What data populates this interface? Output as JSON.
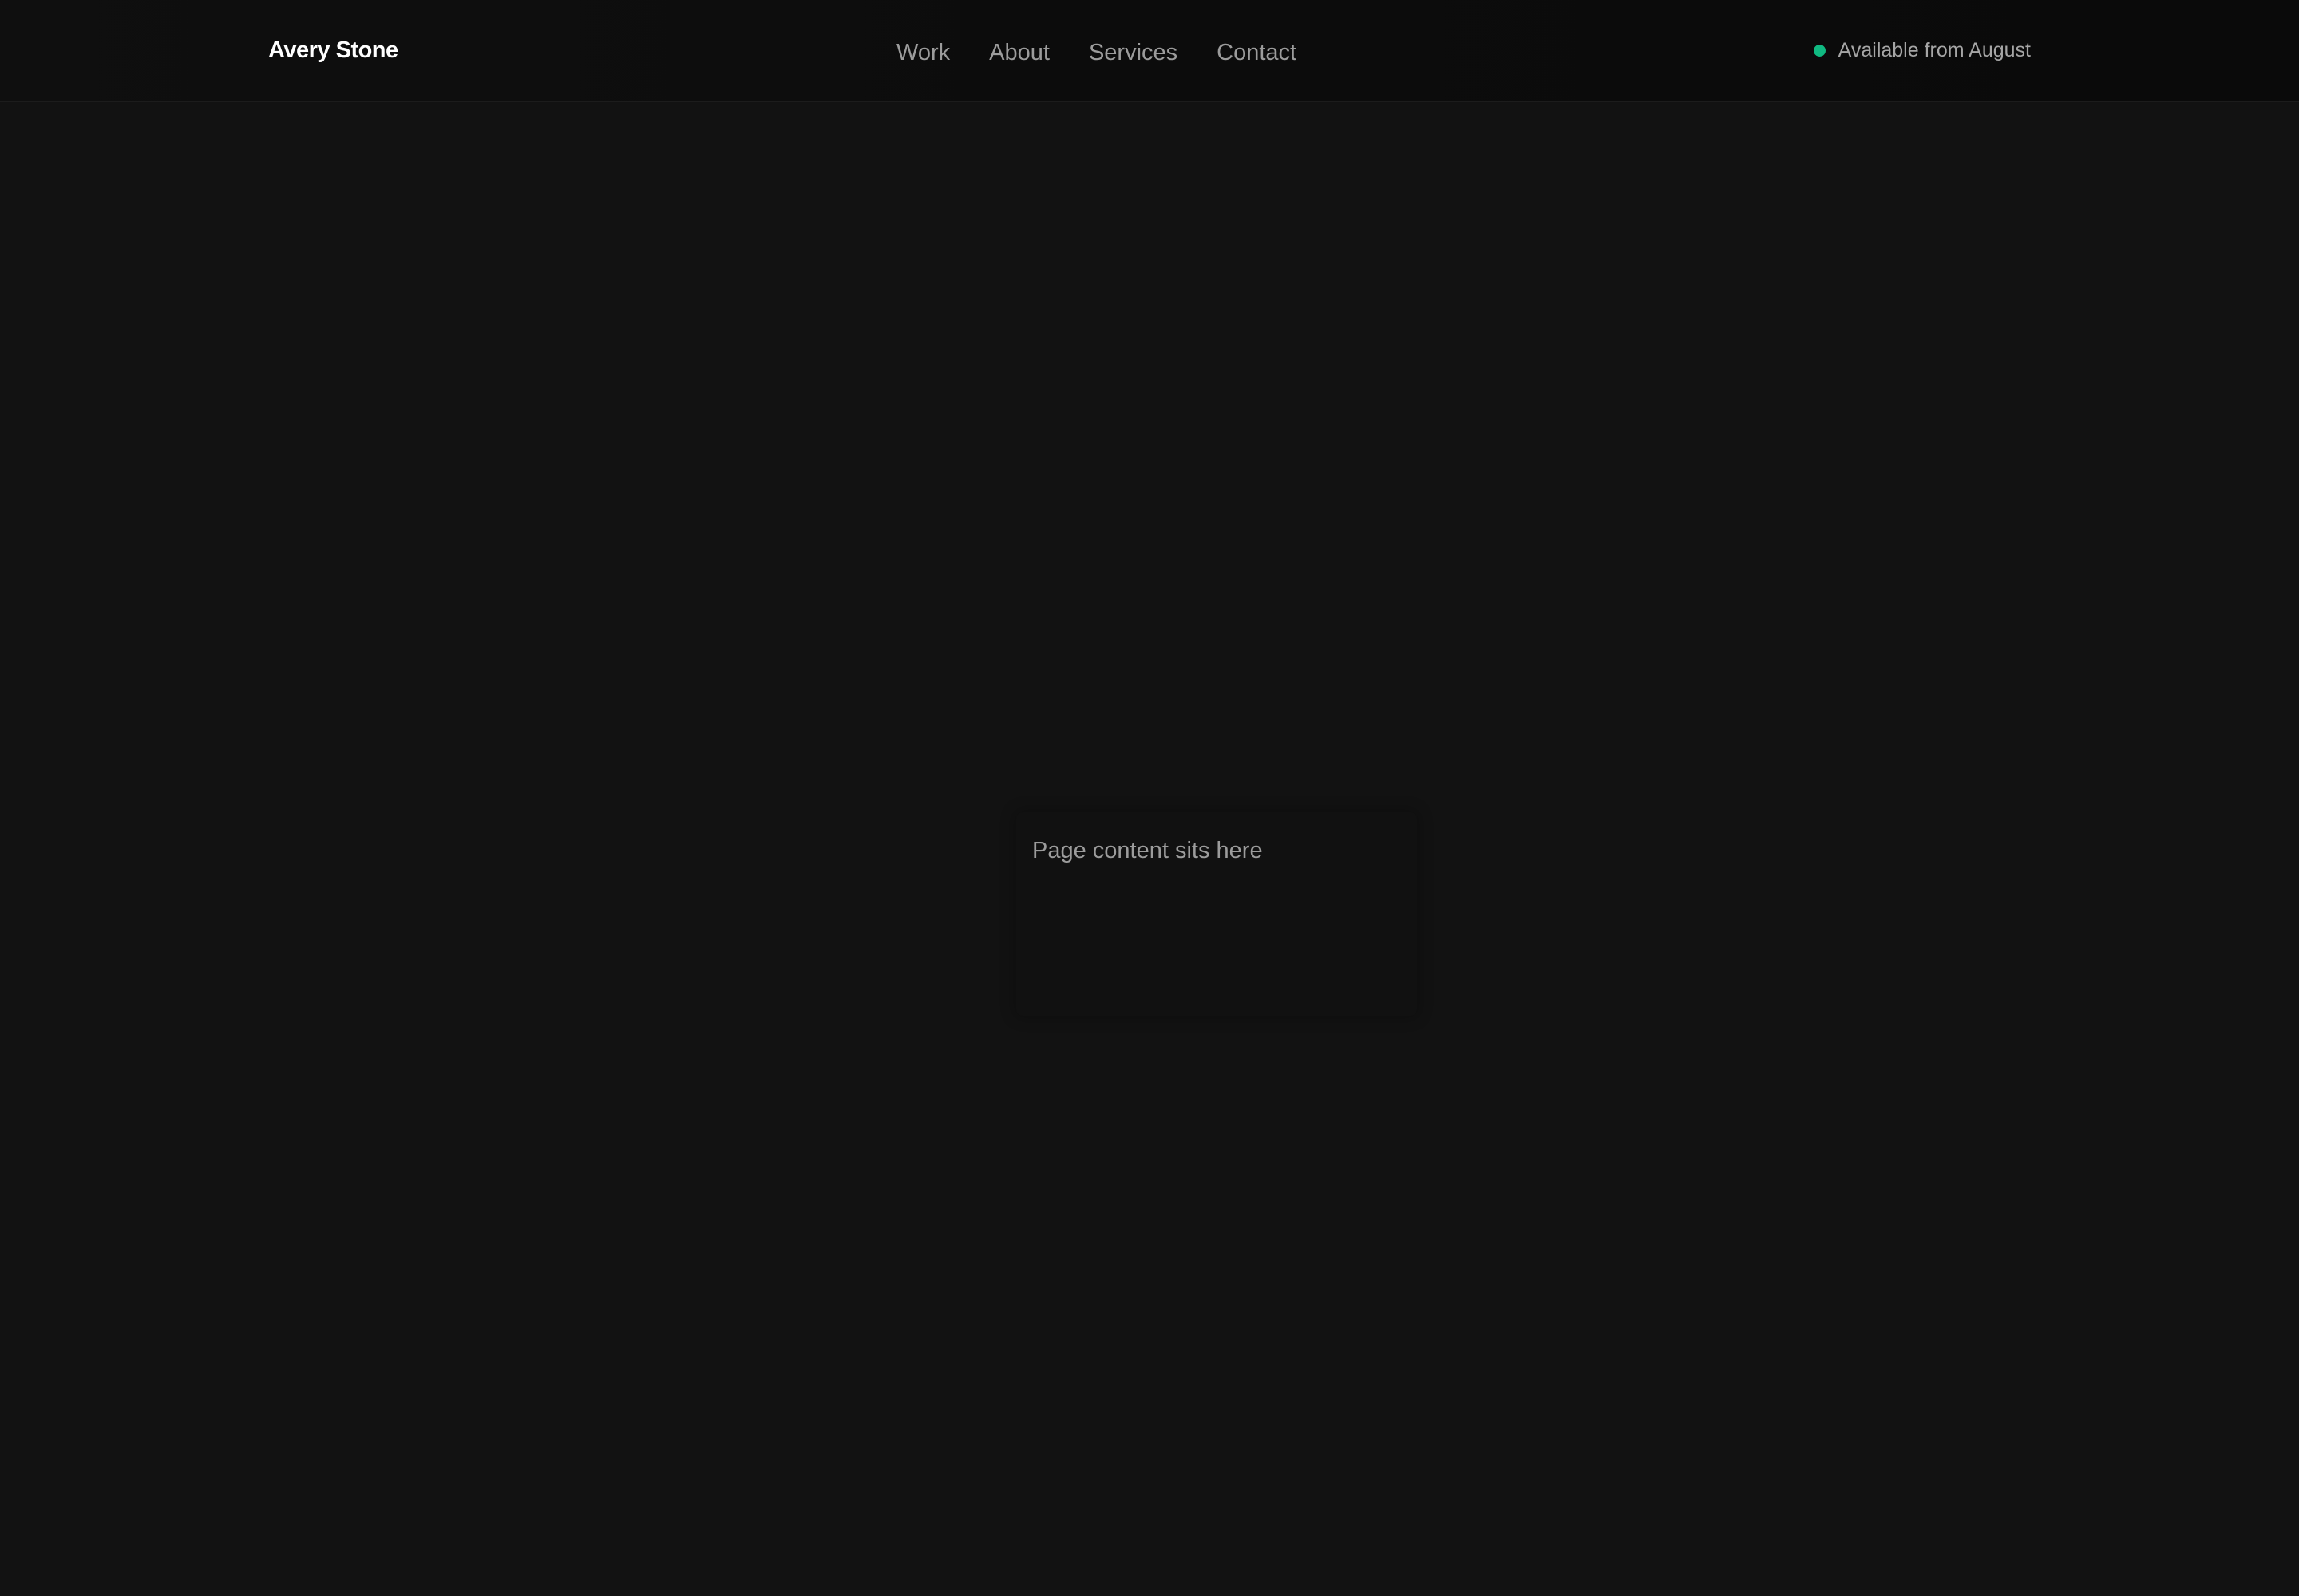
{
  "header": {
    "logo_text": "Avery Stone",
    "nav": [
      {
        "label": "Work"
      },
      {
        "label": "About"
      },
      {
        "label": "Services"
      },
      {
        "label": "Contact"
      }
    ],
    "availability": {
      "text": "Available from August",
      "status_color": "#10b981"
    }
  },
  "main": {
    "placeholder_text": "Page content sits here"
  },
  "colors": {
    "background": "#121212",
    "header_background": "#0c0c0c",
    "logo_text": "#ffffff",
    "nav_text": "#9c9c9c"
  }
}
